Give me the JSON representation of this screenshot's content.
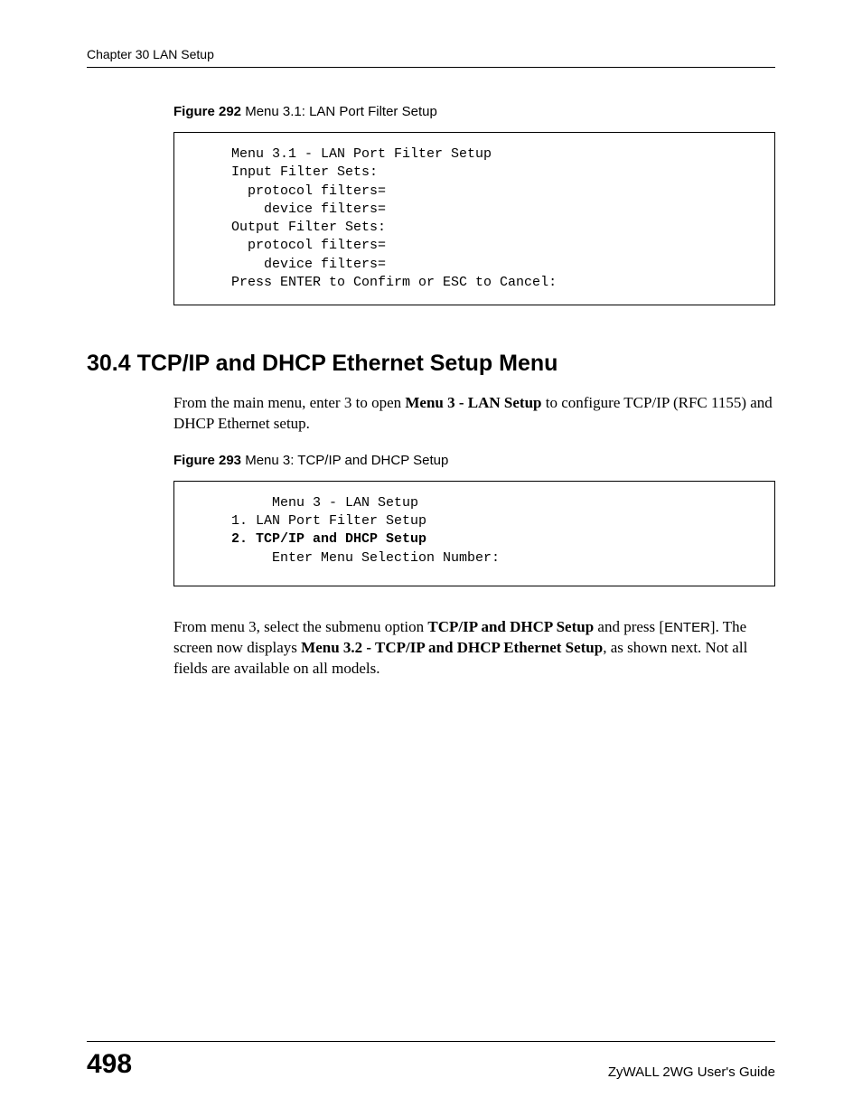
{
  "header": {
    "chapter": "Chapter 30 LAN Setup"
  },
  "figure292": {
    "label": "Figure 292",
    "caption": "   Menu 3.1: LAN Port Filter Setup",
    "lines": {
      "l1": "     Menu 3.1 - LAN Port Filter Setup",
      "l2": "",
      "l3": "     Input Filter Sets:",
      "l4": "       protocol filters=",
      "l5": "         device filters=",
      "l6": "     Output Filter Sets:",
      "l7": "       protocol filters=",
      "l8": "         device filters=",
      "l9": "",
      "l10": "     Press ENTER to Confirm or ESC to Cancel:"
    }
  },
  "section": {
    "heading": "30.4  TCP/IP and DHCP Ethernet Setup Menu",
    "para1_a": "From the main menu, enter 3 to open ",
    "para1_bold": "Menu 3 - LAN Setup",
    "para1_b": " to configure TCP/IP (RFC 1155) and DHCP Ethernet setup."
  },
  "figure293": {
    "label": "Figure 293",
    "caption": "   Menu 3: TCP/IP and DHCP Setup",
    "lines": {
      "l1": "          Menu 3 - LAN Setup",
      "l2": "",
      "l3": "     1. LAN Port Filter Setup",
      "l4": "     2. TCP/IP and DHCP Setup",
      "l5": "",
      "l6": "",
      "l7": "",
      "l8": "          Enter Menu Selection Number:"
    }
  },
  "para2": {
    "a": "From menu 3, select the submenu option ",
    "b1": "TCP/IP and DHCP Setup",
    "c": " and press [",
    "enter": "ENTER",
    "d": "]. The screen now displays ",
    "b2": "Menu 3.2 - TCP/IP and DHCP Ethernet Setup",
    "e": ", as shown next. Not all fields are available on all models."
  },
  "footer": {
    "page": "498",
    "guide": "ZyWALL 2WG User's Guide"
  }
}
